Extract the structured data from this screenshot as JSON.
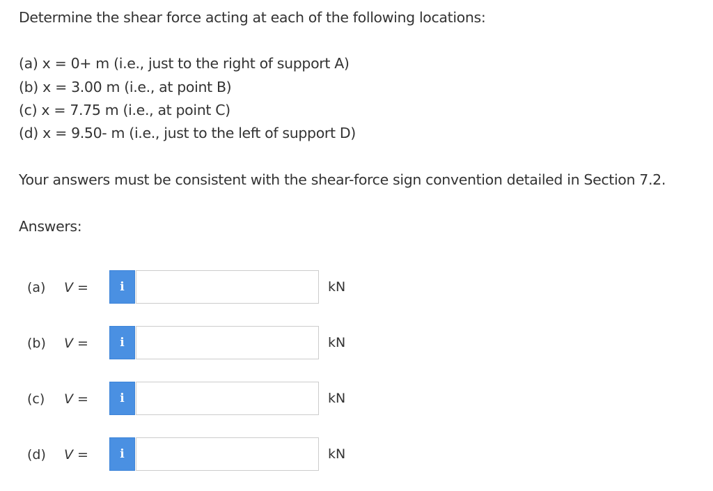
{
  "question": {
    "prompt": "Determine the shear force acting at each of the following locations:",
    "locations": [
      "(a) x = 0+ m (i.e., just to the right of support A)",
      "(b) x = 3.00 m (i.e., at point B)",
      "(c) x = 7.75 m (i.e., at point C)",
      "(d) x = 9.50- m (i.e., just to the left of support D)"
    ],
    "convention_note": "Your answers must be consistent with the shear-force sign convention detailed in Section 7.2.",
    "answers_heading": "Answers:"
  },
  "answers": [
    {
      "part": "(a)",
      "var": "V",
      "eq": "=",
      "info_icon": "i",
      "value": "",
      "unit": "kN"
    },
    {
      "part": "(b)",
      "var": "V",
      "eq": "=",
      "info_icon": "i",
      "value": "",
      "unit": "kN"
    },
    {
      "part": "(c)",
      "var": "V",
      "eq": "=",
      "info_icon": "i",
      "value": "",
      "unit": "kN"
    },
    {
      "part": "(d)",
      "var": "V",
      "eq": "=",
      "info_icon": "i",
      "value": "",
      "unit": "kN"
    }
  ],
  "colors": {
    "info_button": "#4a90e2",
    "text": "#333333",
    "input_border": "#cccccc"
  }
}
